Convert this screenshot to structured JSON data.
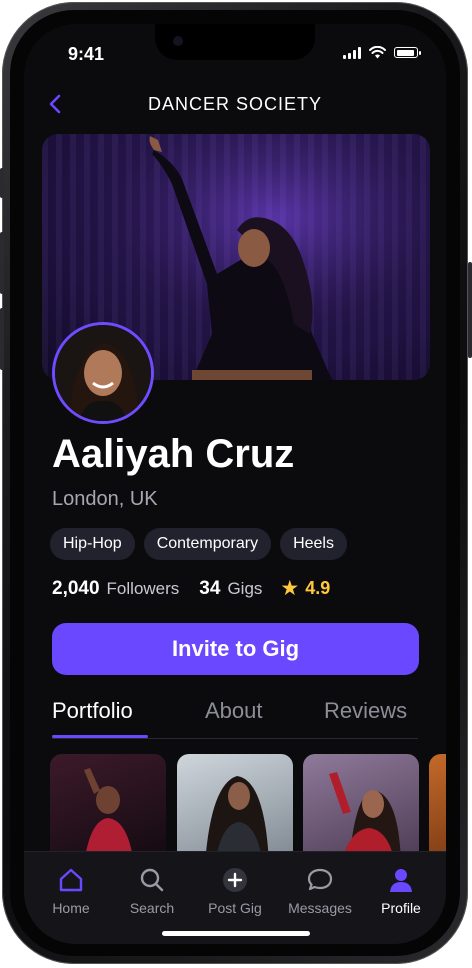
{
  "status_bar": {
    "time": "9:41"
  },
  "header": {
    "title": "DANCER SOCIETY",
    "back_icon": "chevron-left-icon"
  },
  "profile": {
    "name": "Aaliyah Cruz",
    "location": "London, UK",
    "tags": [
      "Hip-Hop",
      "Contemporary",
      "Heels"
    ],
    "followers_count": "2,040",
    "followers_label": "Followers",
    "gigs_count": "34",
    "gigs_label": "Gigs",
    "rating": "4.9"
  },
  "cta": {
    "label": "Invite to Gig"
  },
  "tabs": [
    {
      "label": "Portfolio",
      "active": true
    },
    {
      "label": "About",
      "active": false
    },
    {
      "label": "Reviews",
      "active": false
    }
  ],
  "tab_bar": [
    {
      "label": "Home",
      "icon": "home-icon"
    },
    {
      "label": "Search",
      "icon": "search-icon"
    },
    {
      "label": "Post Gig",
      "icon": "plus-circle-icon"
    },
    {
      "label": "Messages",
      "icon": "chat-icon"
    },
    {
      "label": "Profile",
      "icon": "person-icon",
      "active": true
    }
  ],
  "colors": {
    "accent": "#6a48ff",
    "rating": "#ffc83d",
    "background": "#0b0b0e"
  }
}
